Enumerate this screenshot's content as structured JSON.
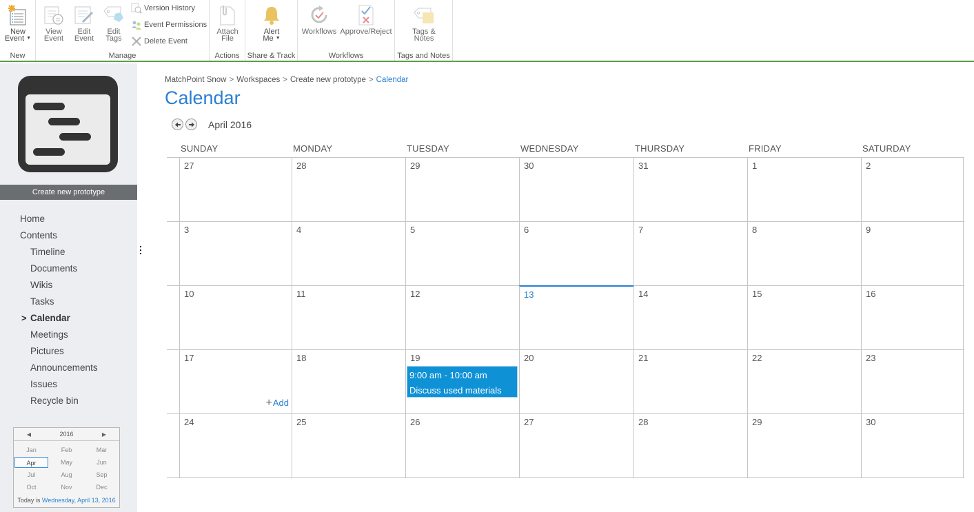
{
  "ribbon": {
    "groups": [
      {
        "label": "New",
        "buttons": [
          {
            "label_line1": "New",
            "label_line2": "Event",
            "icon": "new-event-icon",
            "has_dropdown": true
          }
        ]
      },
      {
        "label": "Manage",
        "buttons": [
          {
            "label_line1": "View",
            "label_line2": "Event",
            "icon": "view-event-icon"
          },
          {
            "label_line1": "Edit",
            "label_line2": "Event",
            "icon": "edit-event-icon"
          },
          {
            "label_line1": "Edit",
            "label_line2": "Tags",
            "icon": "edit-tags-icon"
          }
        ],
        "small_buttons": [
          {
            "label": "Version History",
            "icon": "version-history-icon"
          },
          {
            "label": "Event Permissions",
            "icon": "event-permissions-icon"
          },
          {
            "label": "Delete Event",
            "icon": "delete-icon"
          }
        ]
      },
      {
        "label": "Actions",
        "buttons": [
          {
            "label_line1": "Attach",
            "label_line2": "File",
            "icon": "attach-file-icon"
          }
        ]
      },
      {
        "label": "Share & Track",
        "buttons": [
          {
            "label_line1": "Alert",
            "label_line2": "Me",
            "icon": "bell-icon",
            "has_dropdown": true
          }
        ]
      },
      {
        "label": "Workflows",
        "buttons": [
          {
            "label_line1": "Workflows",
            "label_line2": "",
            "icon": "workflows-icon"
          },
          {
            "label_line1": "Approve/Reject",
            "label_line2": "",
            "icon": "approve-reject-icon"
          }
        ]
      },
      {
        "label": "Tags and Notes",
        "buttons": [
          {
            "label_line1": "Tags &",
            "label_line2": "Notes",
            "icon": "tags-notes-icon"
          }
        ]
      }
    ]
  },
  "sidebar": {
    "site_title": "Create new prototype",
    "nav": [
      {
        "label": "Home",
        "level": 0
      },
      {
        "label": "Contents",
        "level": 0
      },
      {
        "label": "Timeline",
        "level": 1
      },
      {
        "label": "Documents",
        "level": 1
      },
      {
        "label": "Wikis",
        "level": 1
      },
      {
        "label": "Tasks",
        "level": 1
      },
      {
        "label": "Calendar",
        "level": 1,
        "selected": true
      },
      {
        "label": "Meetings",
        "level": 1
      },
      {
        "label": "Pictures",
        "level": 1
      },
      {
        "label": "Announcements",
        "level": 1
      },
      {
        "label": "Issues",
        "level": 1
      },
      {
        "label": "Recycle bin",
        "level": 1
      }
    ],
    "date_picker": {
      "year": "2016",
      "months": [
        "Jan",
        "Feb",
        "Mar",
        "Apr",
        "May",
        "Jun",
        "Jul",
        "Aug",
        "Sep",
        "Oct",
        "Nov",
        "Dec"
      ],
      "selected_month": "Apr",
      "today_prefix": "Today is",
      "today_link": "Wednesday, April 13, 2016"
    }
  },
  "breadcrumb": [
    "MatchPoint Snow",
    "Workspaces",
    "Create new prototype",
    "Calendar"
  ],
  "breadcrumb_separator": ">",
  "page_title": "Calendar",
  "calendar": {
    "month_label": "April 2016",
    "weekdays": [
      "SUNDAY",
      "MONDAY",
      "TUESDAY",
      "WEDNESDAY",
      "THURSDAY",
      "FRIDAY",
      "SATURDAY"
    ],
    "weeks": [
      [
        "27",
        "28",
        "29",
        "30",
        "31",
        "1",
        "2"
      ],
      [
        "3",
        "4",
        "5",
        "6",
        "7",
        "8",
        "9"
      ],
      [
        "10",
        "11",
        "12",
        "13",
        "14",
        "15",
        "16"
      ],
      [
        "17",
        "18",
        "19",
        "20",
        "21",
        "22",
        "23"
      ],
      [
        "24",
        "25",
        "26",
        "27",
        "28",
        "29",
        "30"
      ]
    ],
    "today": {
      "week": 2,
      "day": 3
    },
    "add_link": {
      "week": 3,
      "day": 0,
      "label": "Add"
    },
    "events": [
      {
        "week": 3,
        "day": 2,
        "time": "9:00 am - 10:00 am",
        "title": "Discuss used materials"
      }
    ]
  },
  "colors": {
    "accent": "#2a7fd1",
    "event_bg": "#0f91d6",
    "ribbon_border": "#5b9d46",
    "sidebar_bg": "#eceef2",
    "site_title_bg": "#6b6e70"
  }
}
